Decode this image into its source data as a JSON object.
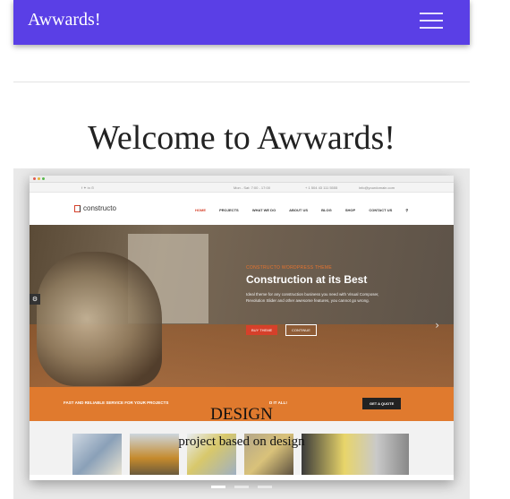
{
  "navbar": {
    "brand": "Awwards!",
    "toggle_icon": "hamburger-menu-icon"
  },
  "headline": "Welcome to Awwards!",
  "carousel": {
    "slides": [
      {
        "screenshot": {
          "topbar": {
            "social": "f  ✦  in  ⊙",
            "hours": "Mon - Sat: 7:00 - 17:00",
            "phone": "+ 1 504 43 111 5555",
            "email": "info@yourdomain.com"
          },
          "logo": "constructo",
          "menu": [
            "HOME",
            "PROJECTS",
            "WHAT WE DO",
            "ABOUT US",
            "BLOG",
            "SHOP",
            "CONTACT US"
          ],
          "hero_kicker": "CONSTRUCTO WORDPRESS THEME",
          "hero_title": "Construction at its Best",
          "hero_desc": "Ideal theme for any construction business you need with Visual Composer, Revolution Slider and other awesome features, you cannot go wrong.",
          "btn_buy": "BUY THEME",
          "btn_continue": "CONTINUE",
          "strip_text": "FAST AND RELIABLE SERVICE FOR YOUR PROJECTS",
          "strip_text_end": "D IT ALL!",
          "strip_button": "GET A QUOTE"
        },
        "caption_title": "DESIGN",
        "caption_sub": "project based on design"
      }
    ],
    "active_index": 0,
    "indicator_count": 3
  },
  "colors": {
    "navbar": "#5a3fe6",
    "accent_orange": "#e07a2e",
    "accent_red": "#d6402a"
  }
}
